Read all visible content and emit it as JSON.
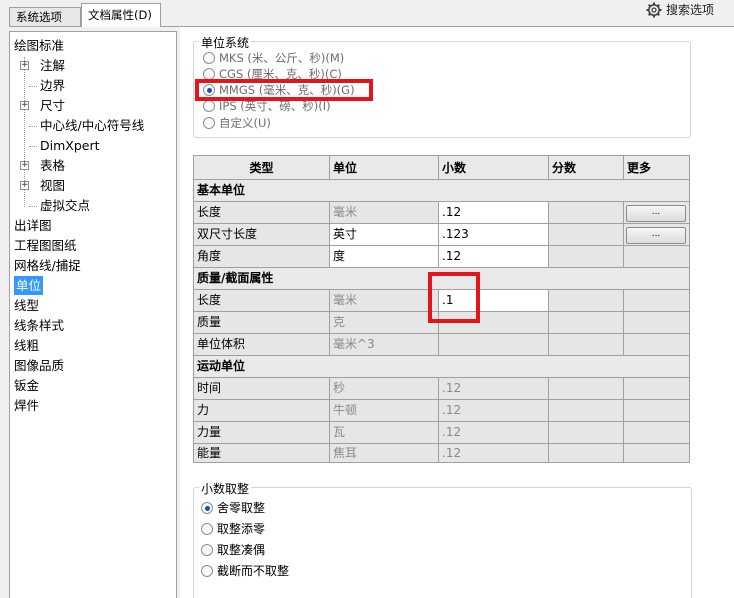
{
  "tabs": [
    {
      "label": "系统选项(S)"
    },
    {
      "label": "文档属性(D)"
    }
  ],
  "search": {
    "label": "搜索选项",
    "icon": "gear-icon"
  },
  "tree": {
    "items": [
      {
        "label": "绘图标准"
      },
      {
        "label": "注解"
      },
      {
        "label": "边界"
      },
      {
        "label": "尺寸"
      },
      {
        "label": "中心线/中心符号线"
      },
      {
        "label": "DimXpert"
      },
      {
        "label": "表格"
      },
      {
        "label": "视图"
      },
      {
        "label": "虚拟交点"
      },
      {
        "label": "出详图"
      },
      {
        "label": "工程图图纸"
      },
      {
        "label": "网格线/捕捉"
      },
      {
        "label": "单位"
      },
      {
        "label": "线型"
      },
      {
        "label": "线条样式"
      },
      {
        "label": "线粗"
      },
      {
        "label": "图像品质"
      },
      {
        "label": "钣金"
      },
      {
        "label": "焊件"
      }
    ],
    "selected": "单位"
  },
  "unit_system": {
    "title": "单位系统",
    "options": [
      {
        "label": "MKS (米、公斤、秒)(M)",
        "checked": false
      },
      {
        "label": "CGS (厘米、克、秒)(C)",
        "checked": false
      },
      {
        "label": "MMGS (毫米、克、秒)(G)",
        "checked": true
      },
      {
        "label": "IPS (英寸、磅、秒)(I)",
        "checked": false
      },
      {
        "label": "自定义(U)",
        "checked": false
      }
    ]
  },
  "units_table": {
    "headers": [
      "类型",
      "单位",
      "小数",
      "分数",
      "更多"
    ],
    "sections": [
      {
        "title": "基本单位"
      },
      {
        "title": "质量/截面属性"
      },
      {
        "title": "运动单位"
      }
    ],
    "rows": [
      {
        "type": "长度",
        "unit": "毫米",
        "decimals": ".12",
        "more": "..."
      },
      {
        "type": "双尺寸长度",
        "unit": "英寸",
        "decimals": ".123",
        "more": "..."
      },
      {
        "type": "角度",
        "unit": "度",
        "decimals": ".12"
      },
      {
        "type": "长度",
        "unit": "毫米",
        "decimals": ".1"
      },
      {
        "type": "质量",
        "unit": "克",
        "decimals": ""
      },
      {
        "type": "单位体积",
        "unit": "毫米^3",
        "decimals": ""
      },
      {
        "type": "时间",
        "unit": "秒",
        "decimals": ".12"
      },
      {
        "type": "力",
        "unit": "牛顿",
        "decimals": ".12"
      },
      {
        "type": "力量",
        "unit": "瓦",
        "decimals": ".12"
      },
      {
        "type": "能量",
        "unit": "焦耳",
        "decimals": ".12"
      }
    ]
  },
  "rounding": {
    "title": "小数取整",
    "options": [
      {
        "label": "舍零取整",
        "checked": true
      },
      {
        "label": "取整添零",
        "checked": false
      },
      {
        "label": "取整凑偶",
        "checked": false
      },
      {
        "label": "截断而不取整",
        "checked": false
      }
    ]
  },
  "highlight_color": "#e4141b",
  "selection_color": "#3399ff"
}
